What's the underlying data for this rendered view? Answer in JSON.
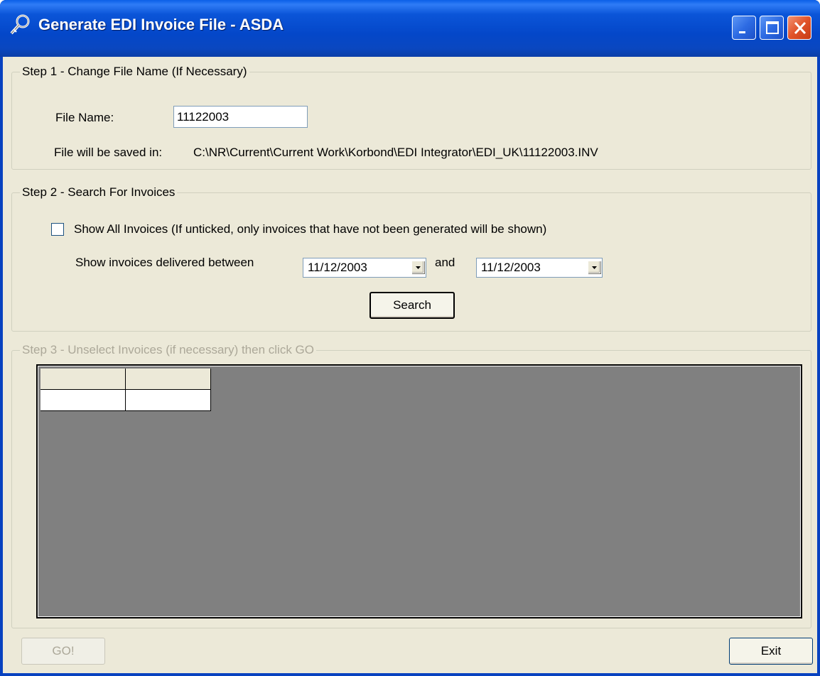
{
  "window": {
    "title": "Generate EDI Invoice File - ASDA"
  },
  "step1": {
    "legend": "Step 1 - Change File Name (If Necessary)",
    "file_name_label": "File Name:",
    "file_name_value": "11122003",
    "saved_in_label": "File will be saved in:",
    "saved_in_path": "C:\\NR\\Current\\Current Work\\Korbond\\EDI Integrator\\EDI_UK\\11122003.INV"
  },
  "step2": {
    "legend": "Step 2 - Search For Invoices",
    "show_all_label": "Show All Invoices (If unticked, only invoices that have not been generated will be shown)",
    "show_all_checked": false,
    "delivered_between_label": "Show invoices delivered between",
    "date_from": "11/12/2003",
    "and_label": "and",
    "date_to": "11/12/2003",
    "search_button": "Search"
  },
  "step3": {
    "legend": "Step 3 - Unselect Invoices (if necessary) then click GO",
    "enabled": false
  },
  "footer": {
    "go_button": "GO!",
    "exit_button": "Exit"
  },
  "colors": {
    "titlebar": "#0447c9",
    "dialog_bg": "#ece9d8",
    "grid_bg": "#808080",
    "disabled_text": "#aca899"
  }
}
